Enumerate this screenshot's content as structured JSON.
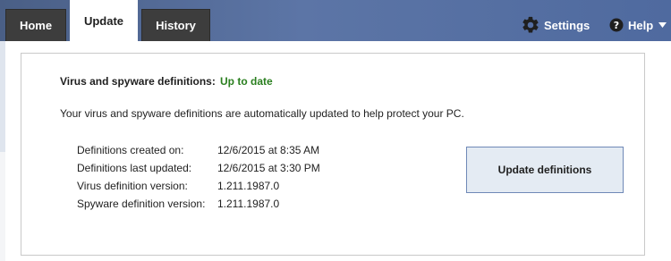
{
  "tabs": [
    {
      "label": "Home",
      "active": false
    },
    {
      "label": "Update",
      "active": true
    },
    {
      "label": "History",
      "active": false
    }
  ],
  "toolbar": {
    "settings_label": "Settings",
    "settings_icon": "gear-icon",
    "help_label": "Help",
    "help_icon": "help-icon",
    "help_dropdown_icon": "chevron-down-icon"
  },
  "status": {
    "label": "Virus and spyware definitions:",
    "value": "Up to date",
    "value_color": "#2a7f1f"
  },
  "description": "Your virus and spyware definitions are automatically updated to help protect your PC.",
  "details": [
    {
      "label": "Definitions created on:",
      "value": "12/6/2015 at 8:35 AM"
    },
    {
      "label": "Definitions last updated:",
      "value": "12/6/2015 at 3:30 PM"
    },
    {
      "label": "Virus definition version:",
      "value": "1.211.1987.0"
    },
    {
      "label": "Spyware definition version:",
      "value": "1.211.1987.0"
    }
  ],
  "update_button_label": "Update definitions",
  "colors": {
    "topbar": "#5d77a8",
    "tab_inactive": "#3d3d3d",
    "button_border": "#6f89b7",
    "button_fill": "#e4ebf3"
  }
}
